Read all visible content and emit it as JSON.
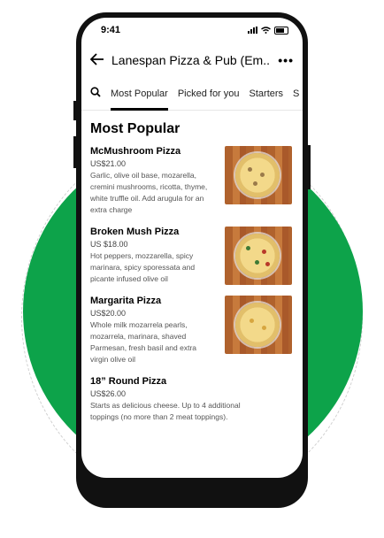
{
  "colors": {
    "accent": "#0da34a",
    "phone_frame": "#111111"
  },
  "status_bar": {
    "time": "9:41"
  },
  "header": {
    "back_icon": "arrow-left-icon",
    "title": "Lanespan Pizza & Pub (Em...",
    "more_label": "•••"
  },
  "tabs": [
    {
      "label": "Most Popular"
    },
    {
      "label": "Picked for you"
    },
    {
      "label": "Starters"
    },
    {
      "label": "S"
    }
  ],
  "section": {
    "title": "Most Popular"
  },
  "items": [
    {
      "name": "McMushroom Pizza",
      "price": "US$21.00",
      "description": "Garlic, olive oil base, mozarella, cremini mushrooms, ricotta, thyme, white truffle oil. Add arugula for an extra charge"
    },
    {
      "name": "Broken Mush Pizza",
      "price": "US $18.00",
      "description": "Hot peppers, mozzarella, spicy marinara, spicy sporessata and picante infused olive oil"
    },
    {
      "name": "Margarita Pizza",
      "price": "US$20.00",
      "description": "Whole milk mozarrela pearls, mozarrela, marinara, shaved Parmesan, fresh basil and extra virgin olive oil"
    },
    {
      "name": "18” Round Pizza",
      "price": "US$26.00",
      "description": "Starts as delicious cheese. Up to 4 additional toppings (no more than 2 meat toppings)."
    }
  ]
}
